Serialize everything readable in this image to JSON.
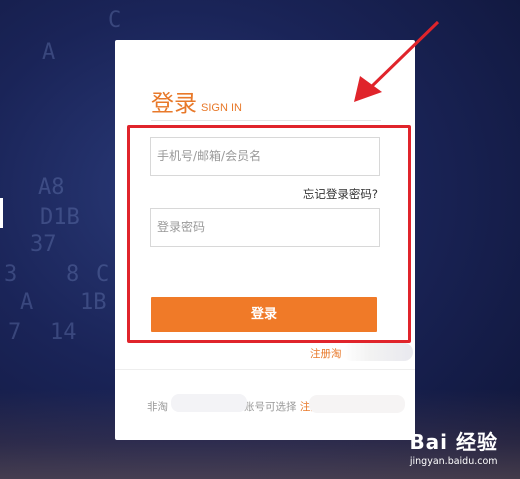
{
  "background": {
    "glyphs": [
      "A",
      "C",
      "A8",
      "D1B",
      "37",
      "8",
      "C",
      "A",
      "1B",
      "3",
      "7",
      "14"
    ]
  },
  "login": {
    "title": "登录",
    "title_en": "SIGN IN",
    "username_placeholder": "手机号/邮箱/会员名",
    "forgot_link": "忘记登录密码?",
    "password_placeholder": "登录密码",
    "submit_label": "登录",
    "register_link": "注册淘",
    "bottom_text_prefix": "非淘",
    "bottom_text_mid": "账号可选择",
    "bottom_link": "注册"
  },
  "colors": {
    "accent": "#e8792a",
    "button": "#f07a28",
    "highlight": "#e0242b"
  },
  "watermark": {
    "brand": "Bai 经验",
    "url": "jingyan.baidu.com"
  }
}
